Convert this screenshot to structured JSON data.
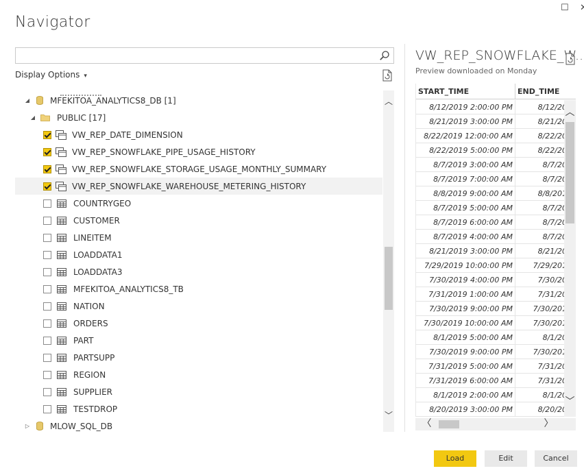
{
  "window": {
    "title": "Navigator",
    "maximize_glyph": "☐",
    "close_glyph": "✕"
  },
  "search": {
    "value": "",
    "placeholder": ""
  },
  "display_options": {
    "label": "Display Options",
    "caret": "▾"
  },
  "tree": {
    "database": {
      "name": "MFEKITOA_ANALYTICS8_DB [1]",
      "expanded": true,
      "arrow": "◢"
    },
    "schema": {
      "name": "PUBLIC [17]",
      "expanded": true,
      "arrow": "◢"
    },
    "items": [
      {
        "label": "VW_REP_DATE_DIMENSION",
        "kind": "view",
        "checked": true
      },
      {
        "label": "VW_REP_SNOWFLAKE_PIPE_USAGE_HISTORY",
        "kind": "view",
        "checked": true
      },
      {
        "label": "VW_REP_SNOWFLAKE_STORAGE_USAGE_MONTHLY_SUMMARY",
        "kind": "view",
        "checked": true
      },
      {
        "label": "VW_REP_SNOWFLAKE_WAREHOUSE_METERING_HISTORY",
        "kind": "view",
        "checked": true,
        "highlighted": true
      },
      {
        "label": "COUNTRYGEO",
        "kind": "table",
        "checked": false
      },
      {
        "label": "CUSTOMER",
        "kind": "table",
        "checked": false
      },
      {
        "label": "LINEITEM",
        "kind": "table",
        "checked": false
      },
      {
        "label": "LOADDATA1",
        "kind": "table",
        "checked": false
      },
      {
        "label": "LOADDATA3",
        "kind": "table",
        "checked": false
      },
      {
        "label": "MFEKITOA_ANALYTICS8_TB",
        "kind": "table",
        "checked": false
      },
      {
        "label": "NATION",
        "kind": "table",
        "checked": false
      },
      {
        "label": "ORDERS",
        "kind": "table",
        "checked": false
      },
      {
        "label": "PART",
        "kind": "table",
        "checked": false
      },
      {
        "label": "PARTSUPP",
        "kind": "table",
        "checked": false
      },
      {
        "label": "REGION",
        "kind": "table",
        "checked": false
      },
      {
        "label": "SUPPLIER",
        "kind": "table",
        "checked": false
      },
      {
        "label": "TESTDROP",
        "kind": "table",
        "checked": false
      }
    ],
    "next_database": {
      "name": "MLOW_SQL_DB",
      "expanded": false,
      "arrow": "▷"
    }
  },
  "preview": {
    "title": "VW_REP_SNOWFLAKE_W...",
    "subtitle": "Preview downloaded on Monday",
    "columns": [
      "START_TIME",
      "END_TIME"
    ],
    "rows": [
      [
        "8/12/2019 2:00:00 PM",
        "8/12/20"
      ],
      [
        "8/21/2019 3:00:00 PM",
        "8/21/20"
      ],
      [
        "8/22/2019 12:00:00 AM",
        "8/22/20"
      ],
      [
        "8/22/2019 5:00:00 PM",
        "8/22/20"
      ],
      [
        "8/7/2019 3:00:00 AM",
        "8/7/20"
      ],
      [
        "8/7/2019 7:00:00 AM",
        "8/7/20"
      ],
      [
        "8/8/2019 9:00:00 AM",
        "8/8/201"
      ],
      [
        "8/7/2019 5:00:00 AM",
        "8/7/20"
      ],
      [
        "8/7/2019 6:00:00 AM",
        "8/7/20"
      ],
      [
        "8/7/2019 4:00:00 AM",
        "8/7/20"
      ],
      [
        "8/21/2019 3:00:00 PM",
        "8/21/20"
      ],
      [
        "7/29/2019 10:00:00 PM",
        "7/29/201"
      ],
      [
        "7/30/2019 4:00:00 PM",
        "7/30/20"
      ],
      [
        "7/31/2019 1:00:00 AM",
        "7/31/20"
      ],
      [
        "7/30/2019 9:00:00 PM",
        "7/30/201"
      ],
      [
        "7/30/2019 10:00:00 AM",
        "7/30/201"
      ],
      [
        "8/1/2019 5:00:00 AM",
        "8/1/20"
      ],
      [
        "7/30/2019 9:00:00 PM",
        "7/30/201"
      ],
      [
        "7/31/2019 5:00:00 AM",
        "7/31/20"
      ],
      [
        "7/31/2019 6:00:00 AM",
        "7/31/20"
      ],
      [
        "8/1/2019 2:00:00 AM",
        "8/1/20"
      ],
      [
        "8/20/2019 3:00:00 PM",
        "8/20/20"
      ]
    ]
  },
  "buttons": {
    "load": "Load",
    "edit": "Edit",
    "cancel": "Cancel"
  },
  "scroll": {
    "up": "︿",
    "down": "﹀",
    "left": "〈",
    "right": "〉"
  },
  "colors": {
    "accent": "#f2c811",
    "folder": "#e8c76a",
    "db": "#d4a93a"
  }
}
